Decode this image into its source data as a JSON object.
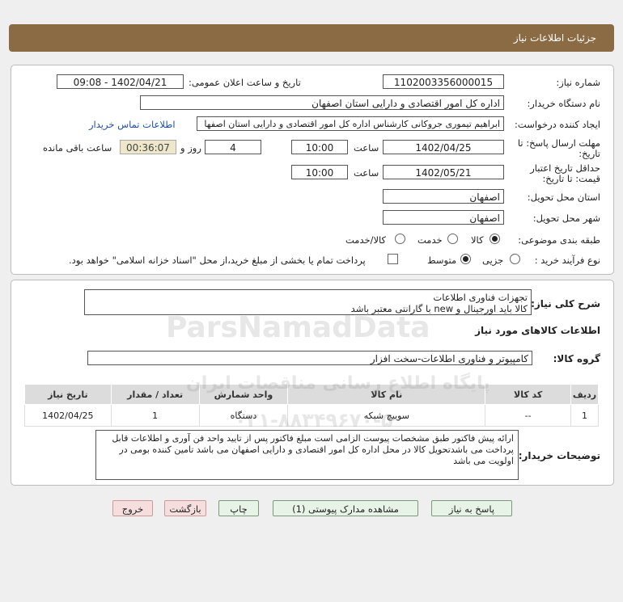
{
  "header": {
    "title": "جزئیات اطلاعات نیاز"
  },
  "need_number": {
    "label": "شماره نیاز:",
    "value": "1102003356000015"
  },
  "announce": {
    "label": "تاریخ و ساعت اعلان عمومی:",
    "value": "1402/04/21 - 09:08"
  },
  "buyer": {
    "label": "نام دستگاه خریدار:",
    "value": "اداره کل امور اقتصادی و دارایی استان اصفهان"
  },
  "creator": {
    "label": "ایجاد کننده درخواست:",
    "value": "ابراهیم تیموری جروکانی کارشناس اداره کل امور اقتصادی و دارایی استان اصفها",
    "contact_link": "اطلاعات تماس خریدار"
  },
  "deadline": {
    "label1": "مهلت ارسال پاسخ: تا",
    "label2": "تاریخ:",
    "date": "1402/04/25",
    "time_label": "ساعت",
    "time": "10:00",
    "days": "4",
    "days_label": "روز و",
    "remaining": "00:36:07",
    "remaining_label": "ساعت باقی مانده"
  },
  "validity": {
    "label1": "حداقل تاریخ اعتبار",
    "label2": "قیمت: تا تاریخ:",
    "date": "1402/05/21",
    "time_label": "ساعت",
    "time": "10:00"
  },
  "province": {
    "label": "استان محل تحویل:",
    "value": "اصفهان"
  },
  "city": {
    "label": "شهر محل تحویل:",
    "value": "اصفهان"
  },
  "category": {
    "label": "طبقه بندی موضوعی:",
    "options": [
      "کالا",
      "خدمت",
      "کالا/خدمت"
    ],
    "selected": "کالا"
  },
  "purchase": {
    "label": "نوع فرآیند خرید :",
    "options": [
      "جزیی",
      "متوسط"
    ],
    "selected": "متوسط",
    "note": "پرداخت تمام یا بخشی از مبلغ خرید،از محل \"اسناد خزانه اسلامی\" خواهد بود."
  },
  "summary": {
    "label": "شرح کلی نیاز:",
    "line1": "تجهزات فناوری اطلاعات",
    "line2": "کالا باید اورجینال و new با  گارانتی معتبر باشد"
  },
  "goods_info_title": "اطلاعات کالاهای مورد نیاز",
  "goods_group": {
    "label": "گروه کالا:",
    "value": "کامپیوتر و فناوری اطلاعات-سخت افزار"
  },
  "table": {
    "headers": [
      "ردیف",
      "کد کالا",
      "نام کالا",
      "واحد شمارش",
      "تعداد / مقدار",
      "تاریخ نیاز"
    ],
    "rows": [
      [
        "1",
        "--",
        "سوییچ شبکه",
        "دستگاه",
        "1",
        "1402/04/25"
      ]
    ]
  },
  "buyer_notes": {
    "label": "توضیحات خریدار:",
    "text": "ارائه پیش فاکتور طبق مشخصات پیوست الزامی است مبلغ فاکتور پس از تایید واحد فن آوری و اطلاعات قابل پرداخت می باشدتحویل کالا در محل اداره کل امور اقتصادی و دارایی اصفهان می باشد تامین کننده بومی در اولویت می باشد"
  },
  "buttons": {
    "reply": "پاسخ به نیاز",
    "attachments": "مشاهده مدارک پیوستی (1)",
    "print": "چاپ",
    "back": "بازگشت",
    "exit": "خروج"
  },
  "watermark": {
    "brand": "ParsNamadData",
    "line_fa": "پایگاه اطلاع رسانی مناقصات ایران",
    "phone": "۰۲۱-۸۸۳۴۹۶۷۰-۵"
  }
}
